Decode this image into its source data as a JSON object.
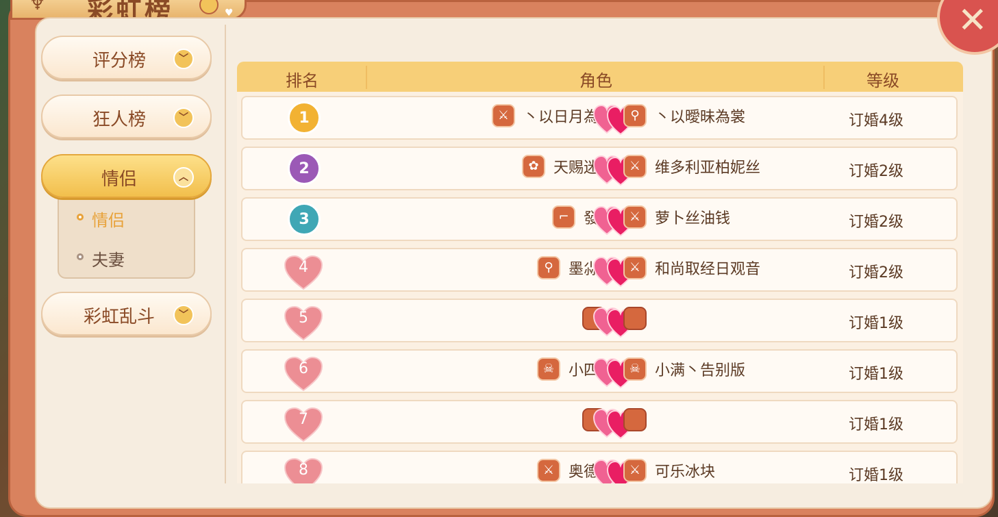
{
  "window": {
    "title": "彩虹榜"
  },
  "sidebar": {
    "items": [
      {
        "label": "评分榜"
      },
      {
        "label": "狂人榜"
      },
      {
        "label": "情侣"
      },
      {
        "label": "彩虹乱斗"
      }
    ],
    "submenu": [
      {
        "label": "情侣",
        "selected": true
      },
      {
        "label": "夫妻",
        "selected": false
      }
    ]
  },
  "table": {
    "headers": [
      "排名",
      "角色",
      "等级"
    ],
    "rows": [
      {
        "rank": "1",
        "left_name": "丶以日月為剑",
        "left_class": "sword-icon",
        "right_name": "丶以曖昧為裳",
        "right_class": "mirror-icon",
        "level": "订婚4级"
      },
      {
        "rank": "2",
        "left_name": "天赐迷惘",
        "left_class": "paw-icon",
        "right_name": "维多利亚柏妮丝",
        "right_class": "sword-icon",
        "level": "订婚2级"
      },
      {
        "rank": "3",
        "left_name": "發財",
        "left_class": "gun-icon",
        "right_name": "萝卜丝油钱",
        "right_class": "sword-icon",
        "level": "订婚2级"
      },
      {
        "rank": "4",
        "left_name": "墨尛尛",
        "left_class": "mirror-icon",
        "right_name": "和尚取经日观音",
        "right_class": "sword-icon",
        "level": "订婚2级"
      },
      {
        "rank": "5",
        "left_name": "",
        "left_class": "blank",
        "right_name": "",
        "right_class": "blank",
        "level": "订婚1级"
      },
      {
        "rank": "6",
        "left_name": "小四叶",
        "left_class": "skull-icon",
        "right_name": "小满丶告别版",
        "right_class": "skull-icon",
        "level": "订婚1级"
      },
      {
        "rank": "7",
        "left_name": "",
        "left_class": "blank",
        "right_name": "",
        "right_class": "blank",
        "level": "订婚1级"
      },
      {
        "rank": "8",
        "left_name": "奥德彪",
        "left_class": "sword-icon",
        "right_name": "可乐冰块",
        "right_class": "sword-icon",
        "level": "订婚1级"
      }
    ]
  },
  "colors": {
    "frame": "#d9825e",
    "panel": "#f6ede0",
    "header": "#f7cf78",
    "active_tab": "#f2bf4c",
    "accent_text": "#e8a23a"
  }
}
